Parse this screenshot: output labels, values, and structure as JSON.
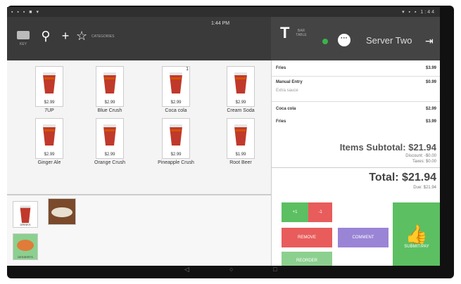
{
  "status_bar": {
    "left_icons": "▪ ▪ ▪ ■ ▾",
    "right_text": "▾ ▪ ▪ 1:44"
  },
  "header": {
    "time": "1:44 PM",
    "server_name": "Server Two",
    "bar_table_label": "BAR TABLE",
    "category_label": "CATEGORIES",
    "keypad_label": "KEY"
  },
  "products": [
    {
      "name": "7UP",
      "price": "$2.99"
    },
    {
      "name": "Blue Crush",
      "price": "$2.99"
    },
    {
      "name": "Coca cola",
      "price": "$2.99",
      "badge": "1"
    },
    {
      "name": "Cream Soda",
      "price": "$2.99"
    },
    {
      "name": "Ginger Ale",
      "price": "$2.99"
    },
    {
      "name": "Orange Crush",
      "price": "$2.99"
    },
    {
      "name": "Pineapple Crush",
      "price": "$2.99"
    },
    {
      "name": "Root Beer",
      "price": "$1.99"
    }
  ],
  "category_thumbs": [
    {
      "label": "DRINKS"
    },
    {
      "label": "MEALS"
    },
    {
      "label": "DESSERTS"
    }
  ],
  "order": {
    "lines": [
      {
        "name": "Fries",
        "price": "$3.99",
        "bold": true
      },
      {
        "name": "Manual Entry",
        "price": "$0.99",
        "bold": true
      },
      {
        "name": "Extra sauce",
        "price": "",
        "bold": false
      },
      {
        "name": "Coca cola",
        "price": "$2.99",
        "bold": true
      },
      {
        "name": "Fries",
        "price": "$3.99",
        "bold": true
      }
    ],
    "items_subtotal": "Items Subtotal: $21.94",
    "discount": "Discount: -$0.00",
    "taxes": "Taxes: $0.00",
    "total": "Total: $21.94",
    "due": "Due: $21.94"
  },
  "buttons": {
    "plus": "+1",
    "minus": "-1",
    "remove": "REMOVE",
    "comment": "COMMENT",
    "submit": "SUBMIT/PAY",
    "reorder": "REORDER"
  },
  "colors": {
    "green": "#5cbf62",
    "red": "#e85c5c",
    "purple": "#9a84d6",
    "light_green": "#8cd08f"
  }
}
